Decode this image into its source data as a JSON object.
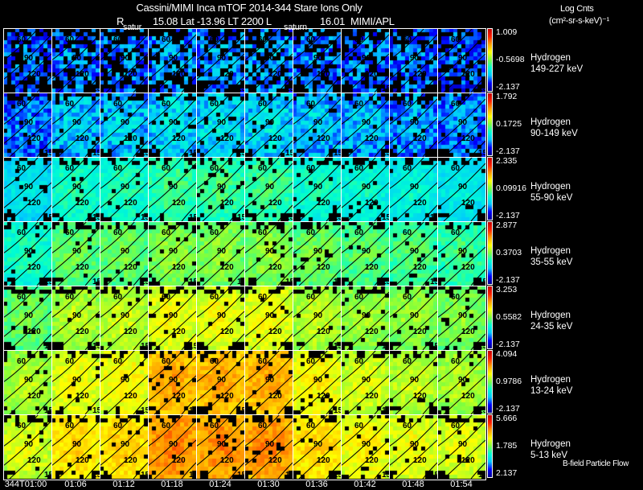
{
  "header": {
    "title": "Cassini/MIMI Inca mTOF  2014-344    Stare    Ions Only",
    "r_label": "R",
    "position": "15.08 Lat -13.96 LT 2200 L",
    "l_value": "16.01",
    "credit": "MIMI/APL",
    "saturn_label_1": "satur",
    "saturn_label_2": "saturn",
    "units_line1": "Log Cnts",
    "units_line2": "(cm²-sr-s-keV)⁻¹"
  },
  "footer_note": "B-field Particle Flow",
  "chart_data": {
    "type": "heatmap",
    "title": "Cassini/MIMI Inca mTOF  2014-344    Stare    Ions Only",
    "x_tick_labels": [
      "344T01:00",
      "01:06",
      "01:12",
      "01:18",
      "01:24",
      "01:30",
      "01:36",
      "01:42",
      "01:48",
      "01:54"
    ],
    "contour_labels": [
      "60",
      "90",
      "120",
      "15"
    ],
    "colormap": [
      "#00008a",
      "#0000ff",
      "#00c8ff",
      "#00ffd0",
      "#7cff40",
      "#ffff00",
      "#ffa000",
      "#ff2000",
      "#c00000"
    ],
    "rows": [
      {
        "species": "Hydrogen",
        "energy": "149-227 keV",
        "cmax": "1.009",
        "cmid": "-0.5698",
        "cmin": "-2.137",
        "mean_level": [
          0.15,
          0.18,
          0.17,
          0.2,
          0.2,
          0.2,
          0.18,
          0.17,
          0.16,
          0.15
        ]
      },
      {
        "species": "Hydrogen",
        "energy": "90-149 keV",
        "cmax": "1.792",
        "cmid": "0.1725",
        "cmin": "-2.137",
        "mean_level": [
          0.16,
          0.24,
          0.25,
          0.27,
          0.27,
          0.27,
          0.24,
          0.22,
          0.2,
          0.18
        ]
      },
      {
        "species": "Hydrogen",
        "energy": "55-90 keV",
        "cmax": "2.335",
        "cmid": "0.09916",
        "cmin": "-2.137",
        "mean_level": [
          0.28,
          0.36,
          0.36,
          0.4,
          0.4,
          0.4,
          0.35,
          0.33,
          0.32,
          0.3
        ]
      },
      {
        "species": "Hydrogen",
        "energy": "35-55 keV",
        "cmax": "2.877",
        "cmid": "0.3703",
        "cmin": "-2.137",
        "mean_level": [
          0.36,
          0.44,
          0.45,
          0.48,
          0.48,
          0.48,
          0.45,
          0.43,
          0.42,
          0.4
        ]
      },
      {
        "species": "Hydrogen",
        "energy": "24-35 keV",
        "cmax": "3.253",
        "cmid": "0.5582",
        "cmin": "-2.137",
        "mean_level": [
          0.45,
          0.52,
          0.54,
          0.58,
          0.58,
          0.58,
          0.53,
          0.5,
          0.49,
          0.47
        ]
      },
      {
        "species": "Hydrogen",
        "energy": "13-24 keV",
        "cmax": "4.094",
        "cmid": "0.9786",
        "cmin": "-2.137",
        "mean_level": [
          0.52,
          0.58,
          0.6,
          0.7,
          0.7,
          0.7,
          0.6,
          0.56,
          0.54,
          0.52
        ]
      },
      {
        "species": "Hydrogen",
        "energy": "5-13 keV",
        "cmax": "5.666",
        "cmid": "1.785",
        "cmin": "2.137",
        "mean_level": [
          0.56,
          0.64,
          0.65,
          0.74,
          0.73,
          0.73,
          0.64,
          0.6,
          0.58,
          0.57
        ]
      }
    ]
  }
}
